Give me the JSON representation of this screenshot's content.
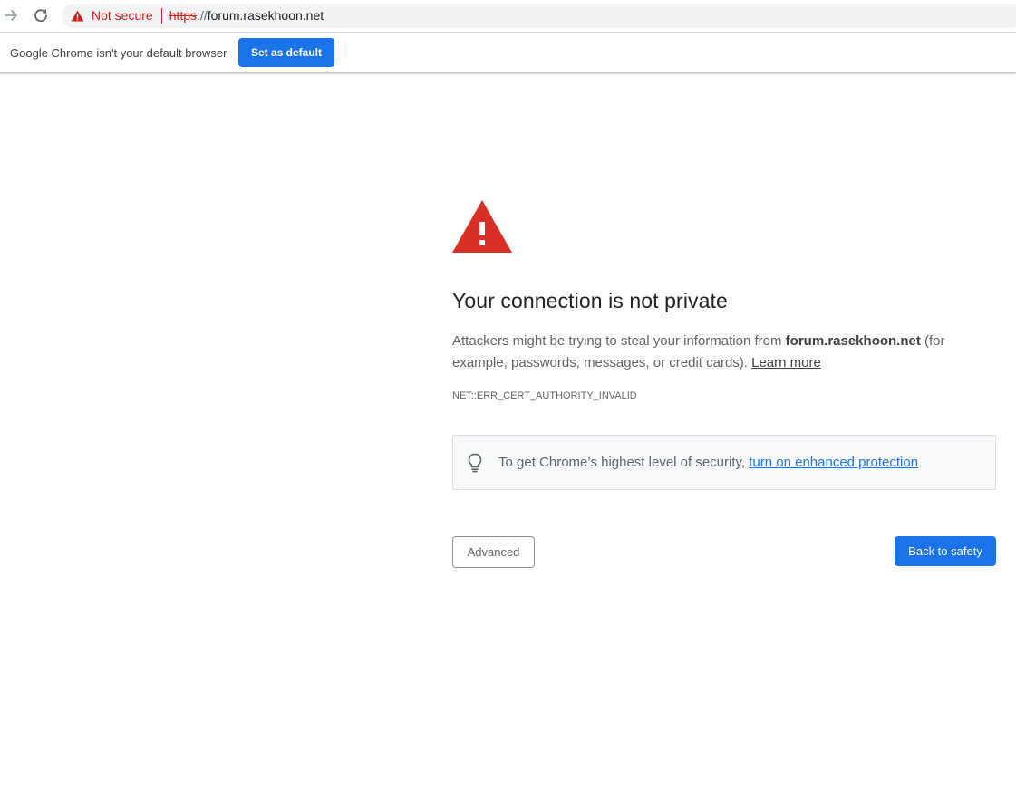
{
  "toolbar": {
    "omnibox": {
      "security_label": "Not secure",
      "url_scheme": "https",
      "url_scheme_rest": "://",
      "url_host": "forum.rasekhoon.net"
    }
  },
  "infobar": {
    "message": "Google Chrome isn't your default browser",
    "button_label": "Set as default"
  },
  "interstitial": {
    "heading": "Your connection is not private",
    "explanation_prefix": "Attackers might be trying to steal your information from ",
    "explanation_host": "forum.rasekhoon.net",
    "explanation_suffix": " (for example, passwords, messages, or credit cards). ",
    "learn_more_label": "Learn more",
    "error_code": "NET::ERR_CERT_AUTHORITY_INVALID",
    "enhanced_prompt": "To get Chrome’s highest level of security, ",
    "enhanced_link": "turn on enhanced protection",
    "advanced_label": "Advanced",
    "back_label": "Back to safety"
  },
  "colors": {
    "danger_red": "#d93025",
    "not_secure_red": "#c5221f",
    "primary_blue": "#1a73e8",
    "omnibox_bg": "#f1f3f4"
  },
  "icons": {
    "forward": "forward-arrow-icon",
    "reload": "reload-icon",
    "omnibox_warning": "warning-triangle-icon",
    "danger": "danger-triangle-icon",
    "bulb": "lightbulb-icon"
  }
}
